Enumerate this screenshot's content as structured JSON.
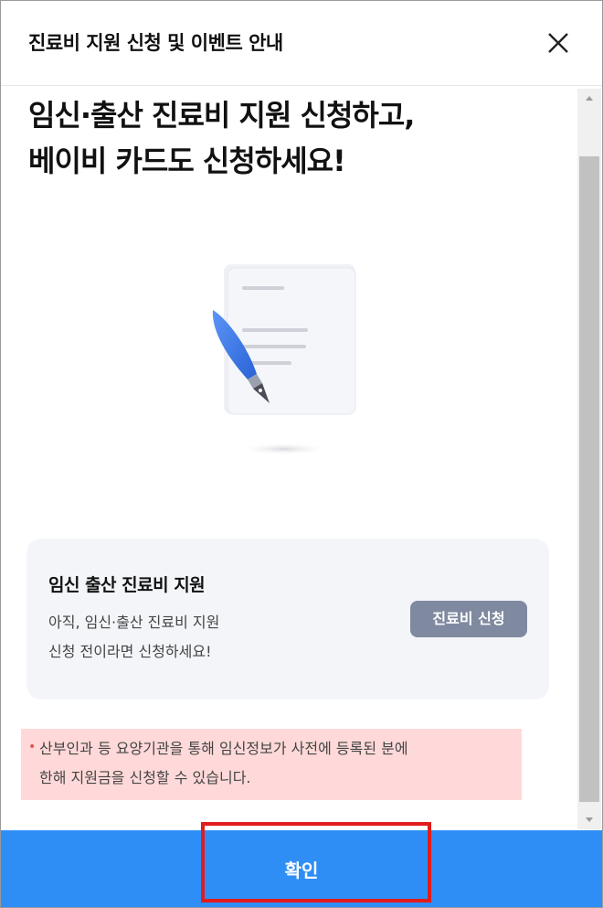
{
  "header": {
    "title": "진료비 지원 신청 및 이벤트 안내",
    "close_icon": "close-icon"
  },
  "headline": {
    "line1": "임신·출산 진료비 지원 신청하고,",
    "line2": "베이비 카드도 신청하세요!"
  },
  "illustration": {
    "icon": "document-pen-icon",
    "colors": {
      "pen": "#3d7cf0",
      "paper": "#f2f3f8",
      "lines": "#c9cbd2"
    }
  },
  "card": {
    "title": "임신 출산 진료비 지원",
    "desc_line1": "아직, 임신·출산 진료비 지원",
    "desc_line2": "신청 전이라면 신청하세요!",
    "button_label": "진료비 신청"
  },
  "notice": {
    "bullet": "•",
    "line1": "산부인과 등 요양기관을 통해 임신정보가 사전에 등록된 분에",
    "line2": "한해 지원금을 신청할 수 있습니다."
  },
  "footer": {
    "confirm_label": "확인"
  },
  "colors": {
    "primary": "#2f8ef6",
    "card_bg": "#f3f5f9",
    "card_button": "#7f8aa0",
    "notice_bg": "#ffd9d9",
    "highlight": "#e01c1c"
  }
}
